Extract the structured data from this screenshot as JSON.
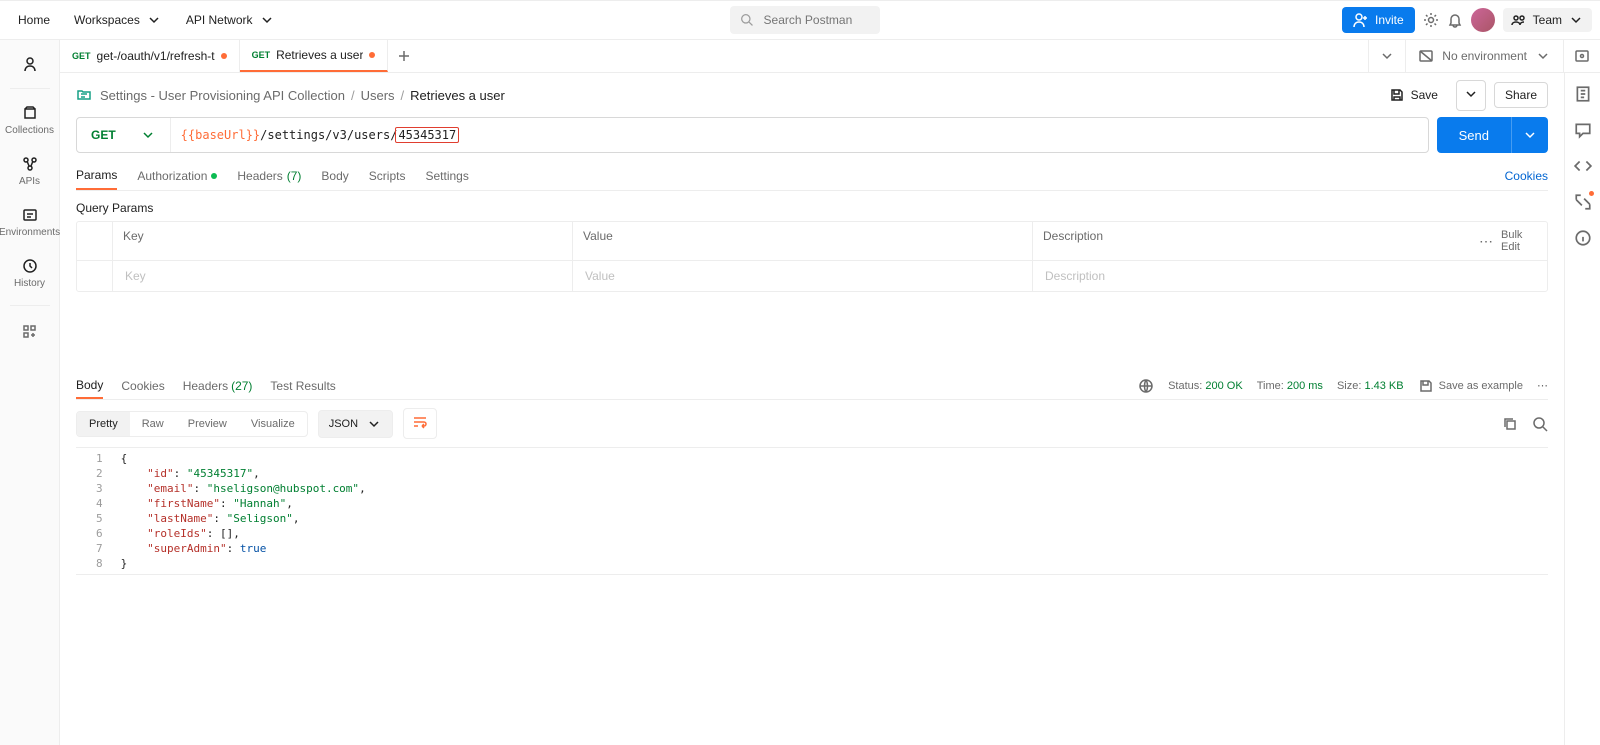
{
  "header": {
    "home": "Home",
    "workspaces": "Workspaces",
    "api_network": "API Network",
    "search_placeholder": "Search Postman",
    "invite": "Invite",
    "team": "Team"
  },
  "leftbar": {
    "collections": "Collections",
    "apis": "APIs",
    "environments": "Environments",
    "history": "History"
  },
  "tabs": [
    {
      "method": "GET",
      "title": "get-/oauth/v1/refresh-t",
      "dirty": true,
      "active": false
    },
    {
      "method": "GET",
      "title": "Retrieves a user",
      "dirty": true,
      "active": true
    }
  ],
  "environment": {
    "label": "No environment"
  },
  "breadcrumb": {
    "collection": "Settings - User Provisioning API Collection",
    "folder": "Users",
    "current": "Retrieves a user"
  },
  "actions": {
    "save": "Save",
    "share": "Share"
  },
  "request": {
    "method": "GET",
    "url_var": "{{baseUrl}}",
    "url_path": "/settings/v3/users/",
    "url_path_highlight": "45345317",
    "send": "Send"
  },
  "req_tabs": {
    "params": "Params",
    "authorization": "Authorization",
    "headers": "Headers",
    "headers_count": "(7)",
    "body": "Body",
    "scripts": "Scripts",
    "settings": "Settings",
    "cookies": "Cookies"
  },
  "query_params": {
    "label": "Query Params",
    "headers": {
      "key": "Key",
      "value": "Value",
      "desc": "Description"
    },
    "placeholders": {
      "key": "Key",
      "value": "Value",
      "desc": "Description"
    },
    "bulk_edit": "Bulk Edit"
  },
  "resp_tabs": {
    "body": "Body",
    "cookies": "Cookies",
    "headers": "Headers",
    "headers_count": "(27)",
    "test_results": "Test Results"
  },
  "resp_status": {
    "status_label": "Status:",
    "status_value": "200 OK",
    "time_label": "Time:",
    "time_value": "200 ms",
    "size_label": "Size:",
    "size_value": "1.43 KB",
    "save_example": "Save as example"
  },
  "resp_view": {
    "pretty": "Pretty",
    "raw": "Raw",
    "preview": "Preview",
    "visualize": "Visualize",
    "format": "JSON"
  },
  "response_body": {
    "id": "45345317",
    "email": "hseligson@hubspot.com",
    "firstName": "Hannah",
    "lastName": "Seligson",
    "roleIds": [],
    "superAdmin": true
  }
}
